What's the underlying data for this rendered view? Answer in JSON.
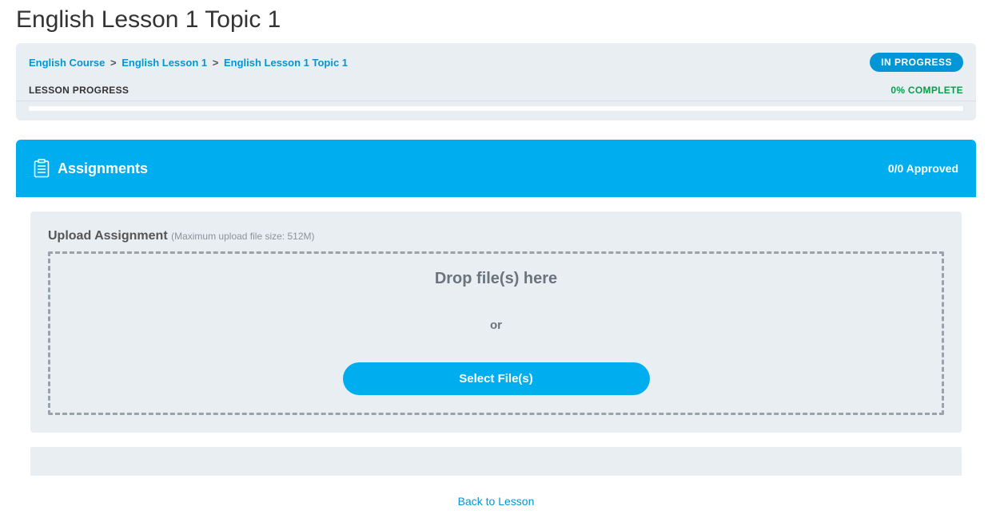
{
  "page": {
    "title": "English Lesson 1 Topic 1"
  },
  "breadcrumb": {
    "items": [
      {
        "label": "English Course"
      },
      {
        "label": "English Lesson 1"
      },
      {
        "label": "English Lesson 1 Topic 1"
      }
    ],
    "separator": ">"
  },
  "status": {
    "badge": "IN PROGRESS"
  },
  "progress": {
    "label": "LESSON PROGRESS",
    "complete_text": "0% COMPLETE",
    "percent": 0
  },
  "assignments": {
    "title": "Assignments",
    "approved": "0/0 Approved",
    "upload": {
      "heading": "Upload Assignment",
      "hint": "(Maximum upload file size: 512M)",
      "drop_text": "Drop file(s) here",
      "or_text": "or",
      "button": "Select File(s)"
    }
  },
  "footer": {
    "back_link": "Back to Lesson"
  }
}
